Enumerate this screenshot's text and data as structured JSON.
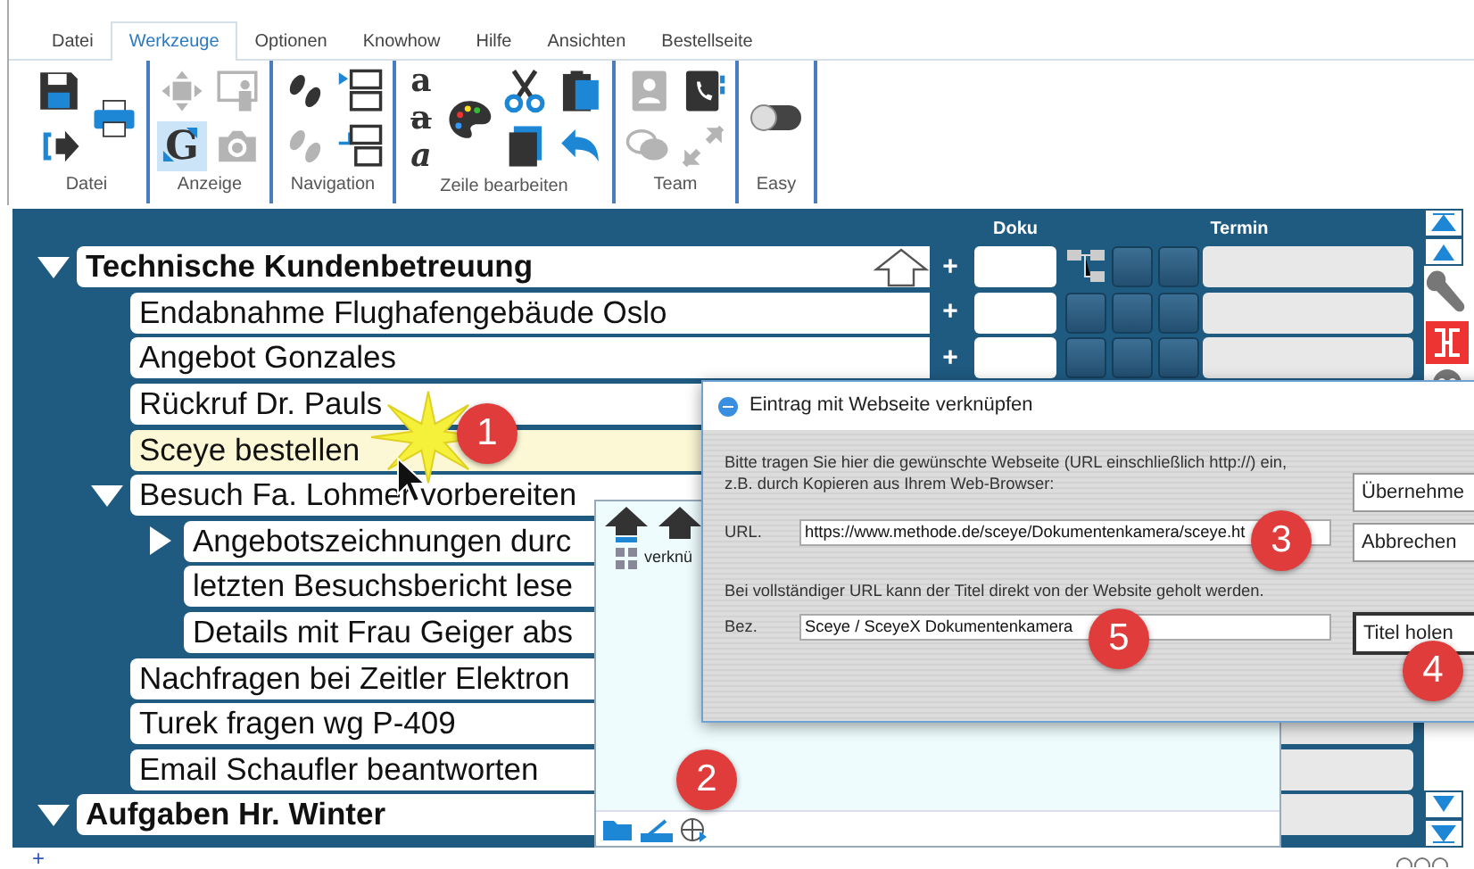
{
  "ribbon": {
    "tabs": [
      {
        "label": "Datei",
        "selected": false
      },
      {
        "label": "Werkzeuge",
        "selected": true
      },
      {
        "label": "Optionen",
        "selected": false
      },
      {
        "label": "Knowhow",
        "selected": false
      },
      {
        "label": "Hilfe",
        "selected": false
      },
      {
        "label": "Ansichten",
        "selected": false
      },
      {
        "label": "Bestellseite",
        "selected": false
      }
    ],
    "groups": [
      {
        "label": "Datei",
        "columns": [
          [
            {
              "kind": "save",
              "disabled": false,
              "highlighted": false
            },
            {
              "kind": "exit",
              "disabled": false,
              "highlighted": false
            }
          ],
          [
            {
              "kind": "print",
              "disabled": false,
              "highlighted": false
            }
          ]
        ]
      },
      {
        "label": "Anzeige",
        "columns": [
          [
            {
              "kind": "move",
              "disabled": true,
              "highlighted": false
            },
            {
              "kind": "zoom",
              "glyph": "G",
              "disabled": false,
              "highlighted": true
            }
          ],
          [
            {
              "kind": "presenter",
              "disabled": true,
              "highlighted": false
            },
            {
              "kind": "camera",
              "disabled": true,
              "highlighted": false
            }
          ]
        ]
      },
      {
        "label": "Navigation",
        "columns": [
          [
            {
              "kind": "footprints",
              "disabled": false,
              "highlighted": false
            },
            {
              "kind": "footprints",
              "disabled": true,
              "highlighted": false
            }
          ],
          [
            {
              "kind": "outline-next",
              "disabled": false,
              "highlighted": false
            },
            {
              "kind": "outline-prev",
              "disabled": false,
              "highlighted": false
            }
          ]
        ]
      },
      {
        "label": "Zeile bearbeiten",
        "columns": [
          [
            {
              "kind": "letter",
              "glyph": "a",
              "disabled": false,
              "highlighted": false
            },
            {
              "kind": "letter",
              "glyph": "a",
              "disabled": false,
              "highlighted": false
            },
            {
              "kind": "letter",
              "glyph": "a",
              "disabled": false,
              "highlighted": false
            }
          ],
          [
            {
              "kind": "palette",
              "disabled": false,
              "highlighted": false
            }
          ],
          [
            {
              "kind": "scissors",
              "disabled": false,
              "highlighted": false
            },
            {
              "kind": "document",
              "disabled": false,
              "highlighted": false
            }
          ],
          [
            {
              "kind": "clipboard",
              "disabled": false,
              "highlighted": false
            },
            {
              "kind": "undo",
              "disabled": false,
              "highlighted": false
            }
          ]
        ]
      },
      {
        "label": "Team",
        "columns": [
          [
            {
              "kind": "contacts",
              "disabled": true,
              "highlighted": false
            },
            {
              "kind": "chat",
              "disabled": true,
              "highlighted": false
            }
          ],
          [
            {
              "kind": "phone",
              "disabled": false,
              "highlighted": false
            },
            {
              "kind": "share",
              "disabled": true,
              "highlighted": false
            }
          ]
        ]
      },
      {
        "label": "Easy",
        "columns": [
          [
            {
              "kind": "toggle",
              "on": false
            }
          ]
        ]
      }
    ]
  },
  "tree": {
    "columns": [
      "Doku",
      "Termin"
    ],
    "nodes": [
      {
        "text": "Technische Kundenbetreuung",
        "expanded": true,
        "selected": false,
        "add": "+",
        "children": [
          {
            "text": "Endabnahme Flughafengebäude Oslo",
            "selected": false,
            "add": "+"
          },
          {
            "text": "Angebot Gonzales",
            "selected": false,
            "add": "+"
          },
          {
            "text": "Rückruf Dr. Pauls",
            "selected": false
          },
          {
            "text": "Sceye bestellen",
            "selected": true
          },
          {
            "text": "Besuch Fa. Lohmer vorbereiten",
            "expanded": true,
            "selected": false,
            "children": [
              {
                "text": "Angebotszeichnungen durc",
                "expanded": false,
                "selected": false
              },
              {
                "text": "letzten Besuchsbericht lese",
                "selected": false
              },
              {
                "text": "Details mit Frau Geiger abs",
                "selected": false
              }
            ]
          },
          {
            "text": "Nachfragen bei Zeitler Elektron",
            "selected": false
          },
          {
            "text": "Turek fragen wg P-409",
            "selected": false
          },
          {
            "text": "Email Schaufler beantworten",
            "selected": false
          }
        ]
      },
      {
        "text": "Aufgaben Hr. Winter",
        "expanded": true,
        "selected": false
      }
    ]
  },
  "link_panel": {
    "items": [
      {
        "text": "verknü"
      }
    ]
  },
  "dialog": {
    "title": "Eintrag mit Webseite verknüpfen",
    "intro": [
      "Bitte tragen Sie hier die gewünschte Webseite (URL einschließlich http://) ein,",
      "z.B. durch Kopieren aus Ihrem Web-Browser:"
    ],
    "url_label": "URL.",
    "url_value": "https://www.methode.de/sceye/Dokumentenkamera/sceye.ht",
    "hint": "Bei vollständiger URL kann der Titel direkt von der Website geholt werden.",
    "title_label": "Bez.",
    "title_value": "Sceye / SceyeX Dokumentenkamera",
    "buttons": [
      "Übernehme",
      "Abbrechen"
    ],
    "fetch_button": "Titel holen"
  },
  "status_bar": {
    "add": "+"
  },
  "callouts": [
    "1",
    "2",
    "3",
    "4",
    "5"
  ]
}
